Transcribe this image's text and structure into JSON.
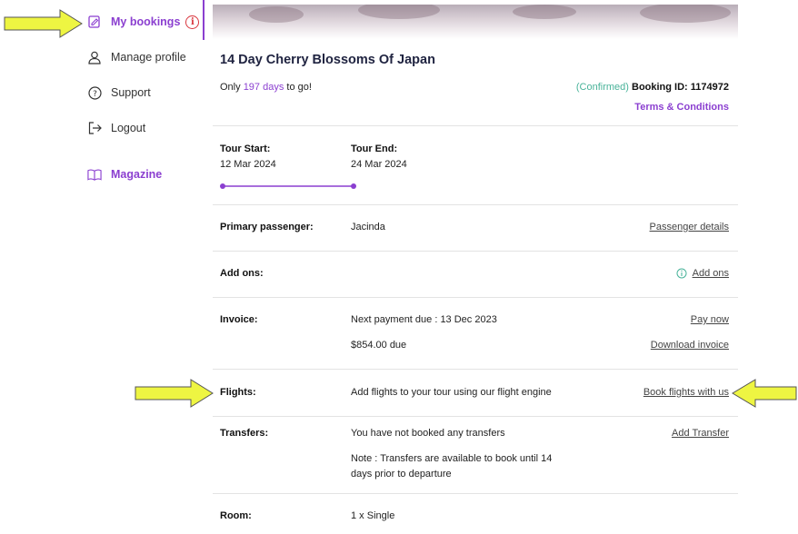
{
  "sidebar": {
    "items": [
      {
        "label": "My bookings",
        "icon": "edit-document-icon",
        "badge": "i"
      },
      {
        "label": "Manage profile",
        "icon": "user-icon"
      },
      {
        "label": "Support",
        "icon": "help-circle-icon"
      },
      {
        "label": "Logout",
        "icon": "logout-icon"
      },
      {
        "label": "Magazine",
        "icon": "book-open-icon"
      }
    ]
  },
  "booking": {
    "title": "14 Day Cherry Blossoms Of Japan",
    "countdown_prefix": "Only",
    "countdown_days": "197 days",
    "countdown_suffix": "to go!",
    "status": "(Confirmed)",
    "booking_id": "Booking ID: 1174972",
    "terms_link": "Terms & Conditions",
    "tour_start_label": "Tour Start:",
    "tour_start_value": "12 Mar 2024",
    "tour_end_label": "Tour End:",
    "tour_end_value": "24 Mar 2024"
  },
  "rows": {
    "passenger": {
      "label": "Primary passenger:",
      "value": "Jacinda",
      "link": "Passenger details"
    },
    "addons": {
      "label": "Add ons:",
      "link": "Add ons"
    },
    "invoice": {
      "label": "Invoice:",
      "value1": "Next payment due : 13 Dec 2023",
      "value2": "$854.00 due",
      "link1": "Pay now",
      "link2": "Download invoice"
    },
    "flights": {
      "label": "Flights:",
      "value": "Add flights to your tour using our flight engine",
      "link": "Book flights with us"
    },
    "transfers": {
      "label": "Transfers:",
      "value1": "You have not booked any transfers",
      "value2_line1": "Note : Transfers are available to book until 14",
      "value2_line2": "days prior to departure",
      "link": "Add Transfer"
    },
    "room": {
      "label": "Room:",
      "value": "1 x Single"
    }
  },
  "colors": {
    "accent": "#8b3fd0",
    "confirmed": "#49b39a",
    "alert": "#d9363e",
    "arrow": "#eef542"
  }
}
